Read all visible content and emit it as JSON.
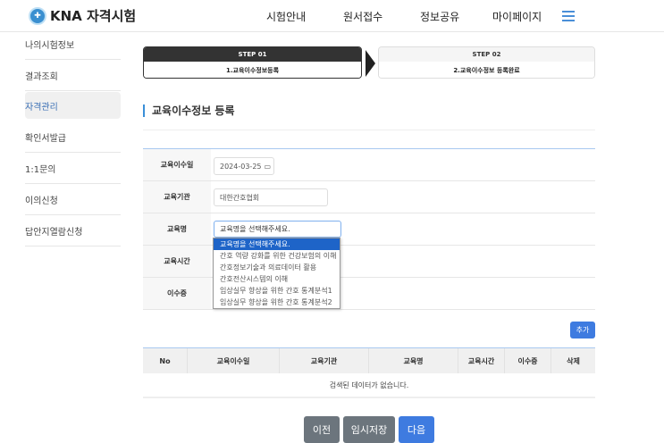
{
  "header": {
    "logo": "KNA 자격시험",
    "nav": [
      "시험안내",
      "원서접수",
      "정보공유",
      "마이페이지"
    ]
  },
  "sidebar": {
    "items": [
      "나의시험정보",
      "결과조회",
      "자격관리",
      "확인서발급",
      "1:1문의",
      "이의신청",
      "답안지열람신청"
    ]
  },
  "steps": [
    {
      "step": "STEP 01",
      "label": "1.교육이수정보등록"
    },
    {
      "step": "STEP 02",
      "label": "2.교육이수정보 등록완료"
    }
  ],
  "page_title": "교육이수정보 등록",
  "form": {
    "date_label": "교육이수일",
    "date_value": "2024-03-25",
    "org_label": "교육기관",
    "org_value": "대한간호협회",
    "course_label": "교육명",
    "course_value": "교육명을 선택해주세요.",
    "hours_label": "교육시간",
    "cert_label": "이수증",
    "options": [
      "교육명을 선택해주세요.",
      "간호 역량 강화를 위한 건강보험의 이해",
      "간호정보기술과 의료데이터 활용",
      "간호전산시스템의 이해",
      "임상실무 향상을 위한 간호 통계분석1",
      "임상실무 향상을 위한 간호 통계분석2"
    ]
  },
  "add_button": "추가",
  "table": {
    "headers": [
      "No",
      "교육이수일",
      "교육기관",
      "교육명",
      "교육시간",
      "이수증",
      "삭제"
    ],
    "empty": "검색된 데이터가 없습니다."
  },
  "buttons": {
    "prev": "이전",
    "save": "임시저장",
    "next": "다음"
  },
  "colors": {
    "accent": "#3e7be0",
    "dark": "#333333",
    "gray_button": "#6c757d"
  }
}
